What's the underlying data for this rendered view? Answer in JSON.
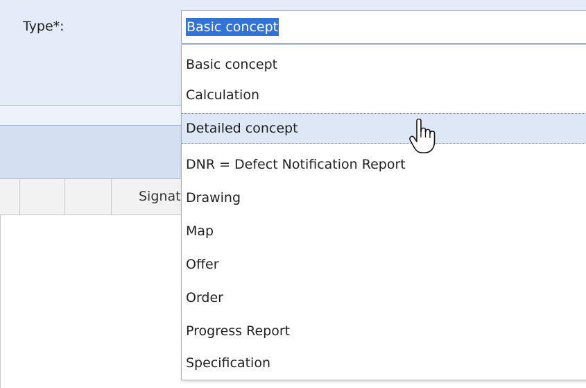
{
  "form": {
    "type_label": "Type*:",
    "type_value": "Basic concept"
  },
  "grid": {
    "signature_header": "Signature"
  },
  "dropdown": {
    "options": [
      "Basic concept",
      "Calculation",
      "Detailed concept",
      "DNR = Defect Notification Report",
      "Drawing",
      "Map",
      "Offer",
      "Order",
      "Progress Report",
      "Specification"
    ],
    "hovered_option": "Detailed concept"
  },
  "colors": {
    "selection_highlight": "#3473d6",
    "panel_background": "#e3ecf8",
    "hover_background": "#dde7f5"
  },
  "icons": {
    "cursor": "hand-pointer-icon"
  }
}
